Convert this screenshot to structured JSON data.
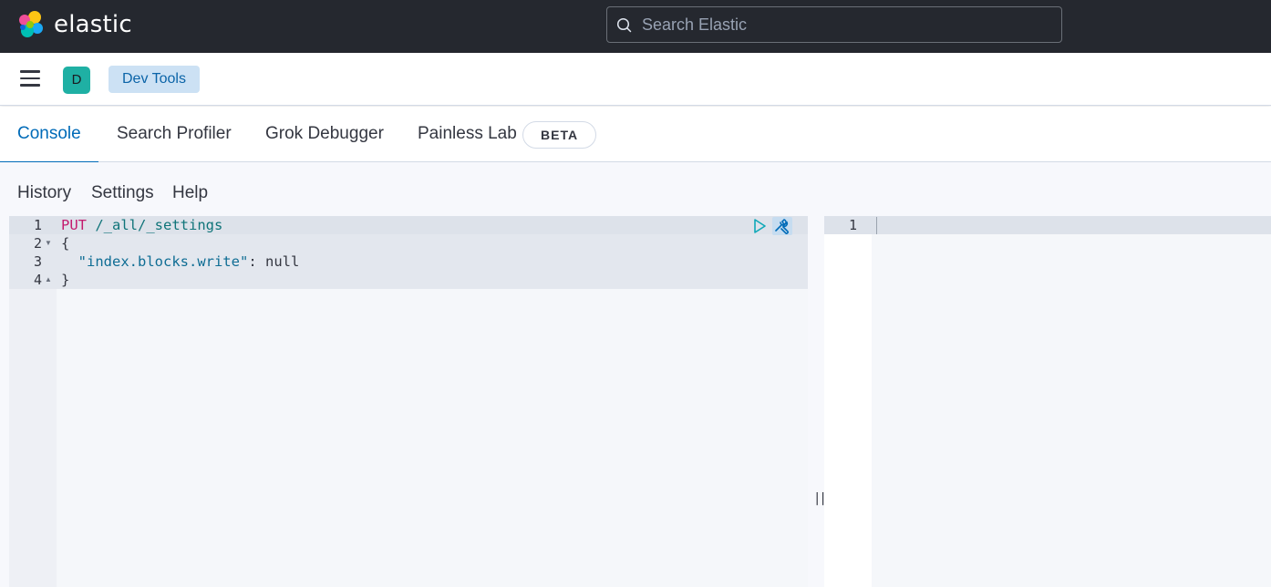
{
  "header": {
    "logo_text": "elastic",
    "search_placeholder": "Search Elastic"
  },
  "subheader": {
    "space_initial": "D",
    "breadcrumb": "Dev Tools"
  },
  "tabs": [
    {
      "label": "Console",
      "active": true
    },
    {
      "label": "Search Profiler",
      "active": false
    },
    {
      "label": "Grok Debugger",
      "active": false
    },
    {
      "label": "Painless Lab",
      "active": false,
      "badge": "BETA"
    }
  ],
  "console_menu": [
    "History",
    "Settings",
    "Help"
  ],
  "editor": {
    "lines": [
      {
        "num": "1",
        "fold": ""
      },
      {
        "num": "2",
        "fold": "▼"
      },
      {
        "num": "3",
        "fold": ""
      },
      {
        "num": "4",
        "fold": "▲"
      }
    ],
    "method": "PUT",
    "path": "/_all/_settings",
    "open_brace": "{",
    "key": "\"index.blocks.write\"",
    "colon": ": ",
    "value": "null",
    "close_brace": "}"
  },
  "output": {
    "line_num": "1"
  },
  "colors": {
    "header_bg": "#25282f",
    "accent": "#006bb8",
    "avatar": "#1fb0a4",
    "method": "#c41c6e"
  }
}
